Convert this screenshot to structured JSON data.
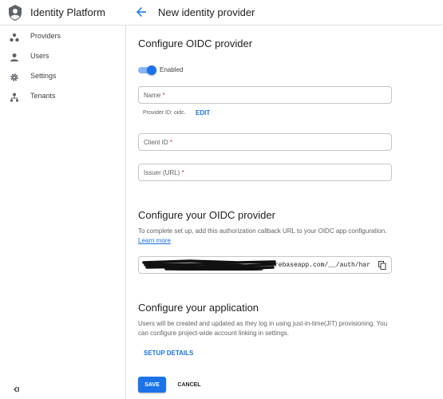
{
  "app": {
    "title": "Identity Platform"
  },
  "header": {
    "title": "New identity provider"
  },
  "sidebar": {
    "items": [
      {
        "label": "Providers",
        "icon": "providers-icon"
      },
      {
        "label": "Users",
        "icon": "person-icon"
      },
      {
        "label": "Settings",
        "icon": "gear-icon"
      },
      {
        "label": "Tenants",
        "icon": "tenants-icon"
      }
    ],
    "collapse_label": "<|"
  },
  "form": {
    "heading": "Configure OIDC provider",
    "enabled_label": "Enabled",
    "enabled": true,
    "name_placeholder": "Name",
    "required_mark": "*",
    "provider_id_hint": "Provider ID: oidc.",
    "edit_label": "EDIT",
    "client_id_placeholder": "Client ID",
    "issuer_placeholder": "Issuer (URL)"
  },
  "oidc": {
    "heading": "Configure your OIDC provider",
    "description": "To complete set up, add this authorization callback URL to your OIDC app configuration.",
    "learn_more": "Learn more",
    "callback_url_visible": "irebaseapp.com/__/auth/har"
  },
  "application": {
    "heading": "Configure your application",
    "description": "Users will be created and updated as they log in using just-in-time(JIT) provisioning. You can configure project-wide account linking in settings.",
    "setup_details": "SETUP DETAILS"
  },
  "actions": {
    "save": "SAVE",
    "cancel": "CANCEL"
  },
  "colors": {
    "accent": "#1a73e8",
    "required": "#d93025"
  }
}
